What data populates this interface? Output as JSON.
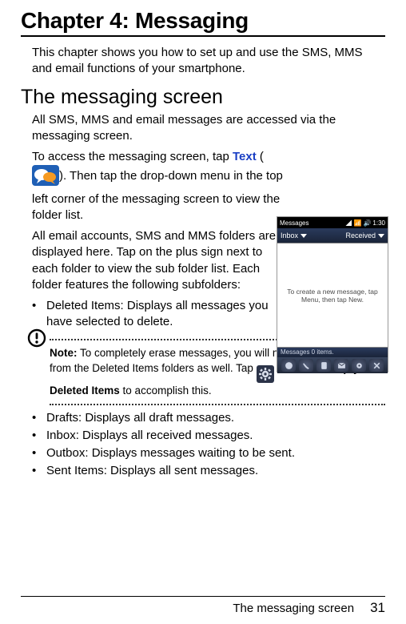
{
  "chapter_title": "Chapter 4: Messaging",
  "intro": "This chapter shows you how to set up and use the SMS, MMS and email functions of your smartphone.",
  "section1_title": "The messaging screen",
  "section1_body1": "All SMS, MMS and email messages are accessed via the messaging screen.",
  "section1_body2_pre": "To access the messaging screen, tap ",
  "section1_body2_link": "Text",
  "section1_body2_paren_open": " (",
  "section1_body2_paren_close": "). Then tap the drop-down menu in the top left corner of the messaging screen to view the folder list.",
  "section1_body3": "All email accounts, SMS and MMS folders are displayed here. Tap on the plus sign next to each folder to view the sub folder list. Each folder features the following subfolders:",
  "bullets_a": [
    "Deleted Items: Displays all messages you have selected to delete."
  ],
  "note_label": "Note:",
  "note_text1": " To completely erase messages, you will need to delete them from the Deleted Items folders as well. Tap ",
  "note_gt1": " > ",
  "note_tools": "Tools",
  "note_gt2": " > ",
  "note_empty": "Empty Deleted Items",
  "note_text2": " to accomplish this.",
  "bullets_b": [
    "Drafts: Displays all draft messages.",
    "Inbox: Displays all received messages.",
    "Outbox: Displays messages waiting to be sent.",
    "Sent Items: Displays all sent messages."
  ],
  "phone": {
    "title": "Messages",
    "time": "1:30",
    "dd_left": "Inbox",
    "dd_right": "Received",
    "body": "To create a new message, tap Menu, then tap New.",
    "status": "Messages  0 items."
  },
  "footer_text": "The messaging screen",
  "page_number": "31"
}
